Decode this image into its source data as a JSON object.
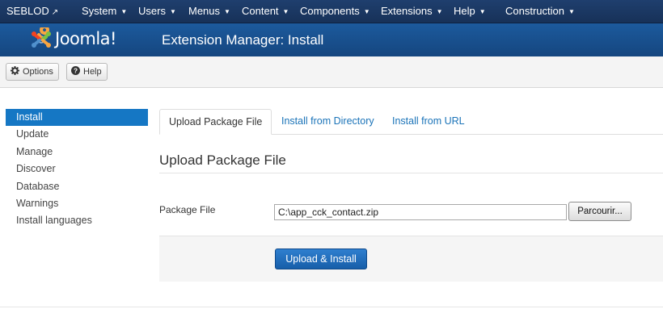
{
  "topnav": {
    "brand": "SEBLOD",
    "menus": [
      "System",
      "Users",
      "Menus",
      "Content",
      "Components",
      "Extensions",
      "Help",
      "Construction"
    ]
  },
  "header": {
    "logo_text": "Joomla!",
    "title": "Extension Manager: Install"
  },
  "toolbar": {
    "options_label": "Options",
    "help_label": "Help"
  },
  "sidebar": {
    "items": [
      {
        "label": "Install",
        "active": true
      },
      {
        "label": "Update"
      },
      {
        "label": "Manage"
      },
      {
        "label": "Discover"
      },
      {
        "label": "Database"
      },
      {
        "label": "Warnings"
      },
      {
        "label": "Install languages"
      }
    ]
  },
  "tabs": [
    {
      "label": "Upload Package File",
      "active": true
    },
    {
      "label": "Install from Directory"
    },
    {
      "label": "Install from URL"
    }
  ],
  "main": {
    "section_title": "Upload Package File",
    "package_label": "Package File",
    "package_value": "C:\\app_cck_contact.zip",
    "browse_label": "Parcourir...",
    "submit_label": "Upload & Install"
  },
  "colors": {
    "topbar": "#173158",
    "header": "#1c5a9d",
    "accent": "#1577c4"
  },
  "icons": [
    "external-link-icon",
    "caret-down-icon",
    "joomla-logo-icon",
    "gear-icon",
    "help-circle-icon"
  ]
}
